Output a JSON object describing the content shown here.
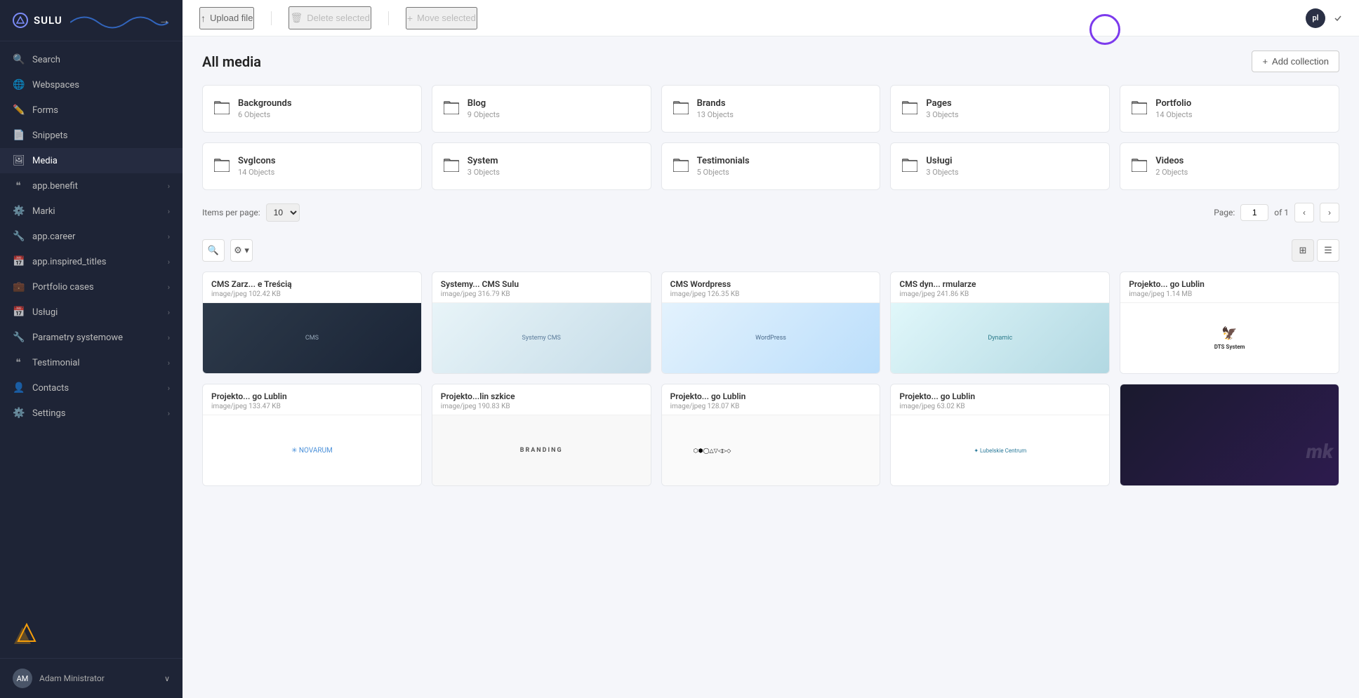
{
  "app": {
    "name": "SULU",
    "lang": "pl"
  },
  "toolbar": {
    "upload_label": "Upload file",
    "delete_label": "Delete selected",
    "move_label": "Move selected"
  },
  "sidebar": {
    "items": [
      {
        "id": "search",
        "label": "Search",
        "icon": "🔍",
        "arrow": false
      },
      {
        "id": "webspaces",
        "label": "Webspaces",
        "icon": "🌐",
        "arrow": false
      },
      {
        "id": "forms",
        "label": "Forms",
        "icon": "✏️",
        "arrow": false
      },
      {
        "id": "snippets",
        "label": "Snippets",
        "icon": "📄",
        "arrow": false
      },
      {
        "id": "media",
        "label": "Media",
        "icon": "🖼",
        "arrow": false,
        "active": true
      },
      {
        "id": "app-benefit",
        "label": "app.benefit",
        "icon": "❝",
        "arrow": true
      },
      {
        "id": "marki",
        "label": "Marki",
        "icon": "⚙️",
        "arrow": true
      },
      {
        "id": "app-career",
        "label": "app.career",
        "icon": "🔧",
        "arrow": true
      },
      {
        "id": "app-inspired",
        "label": "app.inspired_titles",
        "icon": "📅",
        "arrow": true
      },
      {
        "id": "portfolio-cases",
        "label": "Portfolio cases",
        "icon": "💼",
        "arrow": true
      },
      {
        "id": "uslugi",
        "label": "Usługi",
        "icon": "📅",
        "arrow": true
      },
      {
        "id": "parametry",
        "label": "Parametry systemowe",
        "icon": "🔧",
        "arrow": true
      },
      {
        "id": "testimonial",
        "label": "Testimonial",
        "icon": "❝",
        "arrow": true
      },
      {
        "id": "contacts",
        "label": "Contacts",
        "icon": "👤",
        "arrow": true
      },
      {
        "id": "settings",
        "label": "Settings",
        "icon": "⚙️",
        "arrow": true
      }
    ],
    "user": {
      "name": "Adam Ministrator",
      "initials": "AM"
    }
  },
  "all_media": {
    "title": "All media",
    "add_collection_label": "+ Add collection",
    "folders": [
      {
        "name": "Backgrounds",
        "count": "6 Objects"
      },
      {
        "name": "Blog",
        "count": "9 Objects"
      },
      {
        "name": "Brands",
        "count": "13 Objects"
      },
      {
        "name": "Pages",
        "count": "3 Objects"
      },
      {
        "name": "Portfolio",
        "count": "14 Objects"
      },
      {
        "name": "SvgIcons",
        "count": "14 Objects"
      },
      {
        "name": "System",
        "count": "3 Objects"
      },
      {
        "name": "Testimonials",
        "count": "5 Objects"
      },
      {
        "name": "Usługi",
        "count": "3 Objects"
      },
      {
        "name": "Videos",
        "count": "2 Objects"
      }
    ]
  },
  "pagination": {
    "items_per_page_label": "Items per page:",
    "per_page_value": "10",
    "page_label": "Page:",
    "page_value": "1",
    "of_label": "of 1"
  },
  "media_items": [
    {
      "name": "CMS Zarz... e Treścią",
      "meta": "image/jpeg 102.42 KB",
      "thumb_type": "cms-dark"
    },
    {
      "name": "Systemy... CMS Sulu",
      "meta": "image/jpeg 316.79 KB",
      "thumb_type": "cms-blue"
    },
    {
      "name": "CMS Wordpress",
      "meta": "image/jpeg 126.35 KB",
      "thumb_type": "wordpress"
    },
    {
      "name": "CMS dyn... rmularze",
      "meta": "image/jpeg 241.86 KB",
      "thumb_type": "dyn"
    },
    {
      "name": "Projekto... go Lublin",
      "meta": "image/jpeg 1.14 MB",
      "thumb_type": "dts"
    },
    {
      "name": "Projekto... go Lublin",
      "meta": "image/jpeg 133.47 KB",
      "thumb_type": "novarum"
    },
    {
      "name": "Projekto...lin szkice",
      "meta": "image/jpeg 190.83 KB",
      "thumb_type": "branding"
    },
    {
      "name": "Projekto... go Lublin",
      "meta": "image/jpeg 128.07 KB",
      "thumb_type": "icons-sketch"
    },
    {
      "name": "Projekto... go Lublin",
      "meta": "image/jpeg 63.02 KB",
      "thumb_type": "lctt"
    },
    {
      "name": "",
      "meta": "",
      "thumb_type": "portfolio-dark"
    }
  ]
}
